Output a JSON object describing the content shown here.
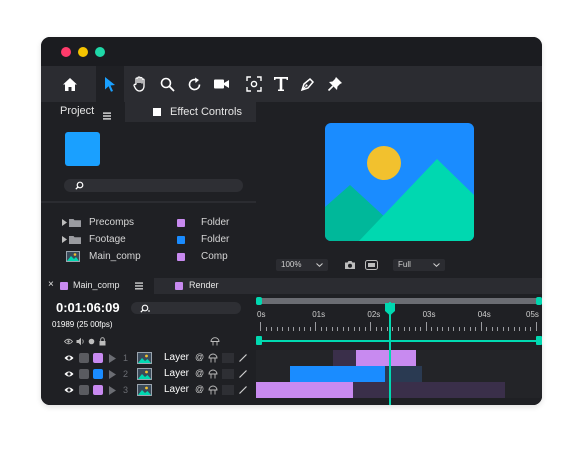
{
  "colors": {
    "accent": "#00d8b0",
    "blue": "#1a8cff",
    "purple": "#c88af0",
    "yellow": "#f2c12e",
    "close": "#ff3b6b",
    "minimize": "#f5c400",
    "maximize": "#1fd8a8"
  },
  "toolbar": {
    "icons": [
      "home-icon",
      "select-arrow-icon",
      "hand-icon",
      "zoom-icon",
      "rotate-icon",
      "camera-icon",
      "anchor-point-icon",
      "text-tool-icon",
      "pen-tool-icon",
      "pin-icon"
    ]
  },
  "project_panel": {
    "tab_label": "Project",
    "menu_icon": "menu-icon",
    "effect_controls_label": "Effect Controls",
    "items": [
      {
        "name": "Precomps",
        "type": "Folder",
        "type_color": "#c88af0",
        "icon": "folder-icon"
      },
      {
        "name": "Footage",
        "type": "Folder",
        "type_color": "#1a8cff",
        "icon": "folder-icon"
      },
      {
        "name": "Main_comp",
        "type": "Comp",
        "type_color": "#c88af0",
        "icon": "comp-icon"
      }
    ]
  },
  "viewer": {
    "zoom_value": "100%",
    "resolution_value": "Full",
    "icons": [
      "snapshot-camera-icon",
      "show-channel-icon"
    ]
  },
  "timeline": {
    "comp_tab_label": "Main_comp",
    "render_tab_label": "Render",
    "timecode": "0:01:06:09",
    "frame_info": "01989 (25 00fps)",
    "ruler_ticks": [
      "0s",
      "01s",
      "02s",
      "03s",
      "04s",
      "05s"
    ],
    "playhead_fraction": 0.47,
    "layers": [
      {
        "index": "1",
        "name": "Layer",
        "label_color": "#c88af0",
        "bar_start": 0.35,
        "bar_end": 0.56,
        "bar_color": "#c88af0",
        "shade_start": 0.27,
        "shade_end": 0.56
      },
      {
        "index": "2",
        "name": "Layer",
        "label_color": "#1a8cff",
        "bar_start": 0.12,
        "bar_end": 0.45,
        "bar_color": "#1a8cff",
        "shade_start": 0.12,
        "shade_end": 0.58
      },
      {
        "index": "3",
        "name": "Layer",
        "label_color": "#c88af0",
        "bar_start": 0.0,
        "bar_end": 0.34,
        "bar_color": "#c88af0",
        "shade_start": 0.0,
        "shade_end": 0.87
      }
    ]
  }
}
